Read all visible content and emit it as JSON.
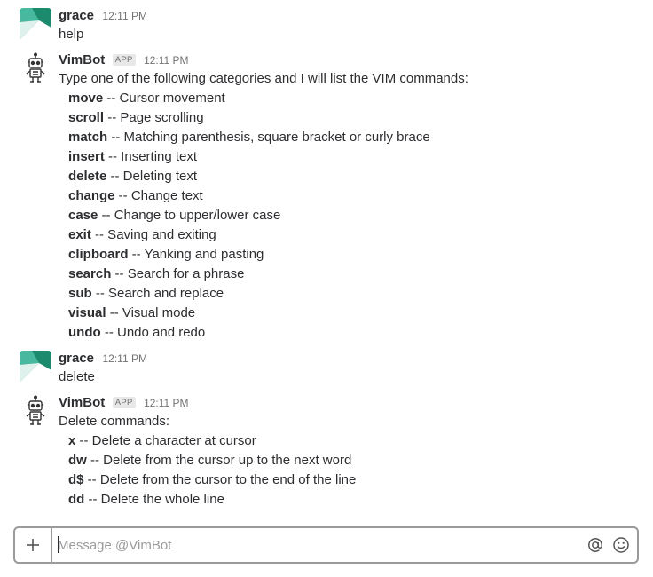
{
  "messages": [
    {
      "sender": "grace",
      "time": "12:11 PM",
      "text": "help"
    },
    {
      "sender": "VimBot",
      "badge": "APP",
      "time": "12:11 PM",
      "intro": "Type one of the following categories and I will list the VIM commands:",
      "items": [
        {
          "name": "move",
          "desc": " -- Cursor movement"
        },
        {
          "name": "scroll",
          "desc": " -- Page scrolling"
        },
        {
          "name": "match",
          "desc": " -- Matching parenthesis, square bracket or curly brace"
        },
        {
          "name": "insert",
          "desc": " -- Inserting text"
        },
        {
          "name": "delete",
          "desc": " -- Deleting text"
        },
        {
          "name": "change",
          "desc": " -- Change text"
        },
        {
          "name": "case",
          "desc": " -- Change to upper/lower case"
        },
        {
          "name": "exit",
          "desc": " -- Saving and exiting"
        },
        {
          "name": "clipboard",
          "desc": " -- Yanking and pasting"
        },
        {
          "name": "search",
          "desc": " -- Search for a phrase"
        },
        {
          "name": "sub",
          "desc": " -- Search and replace"
        },
        {
          "name": "visual",
          "desc": " -- Visual mode"
        },
        {
          "name": "undo",
          "desc": " -- Undo and redo"
        }
      ]
    },
    {
      "sender": "grace",
      "time": "12:11 PM",
      "text": "delete"
    },
    {
      "sender": "VimBot",
      "badge": "APP",
      "time": "12:11 PM",
      "intro": "Delete commands:",
      "items": [
        {
          "name": "x",
          "desc": " -- Delete a character at cursor"
        },
        {
          "name": "dw",
          "desc": " -- Delete from the cursor up to the next word"
        },
        {
          "name": "d$",
          "desc": " -- Delete from the cursor to the end of the line"
        },
        {
          "name": "dd",
          "desc": " -- Delete the whole line"
        }
      ]
    }
  ],
  "composer": {
    "placeholder": "Message @VimBot",
    "plus_icon": "plus-icon",
    "mention_icon": "at-sign-icon",
    "emoji_icon": "smiley-icon"
  },
  "colors": {
    "text": "#2c2d30",
    "muted": "#717274",
    "grace_avatar_dark": "#1c8a6d",
    "grace_avatar_light": "#48b89e",
    "composer_border": "#9a9a9d"
  }
}
